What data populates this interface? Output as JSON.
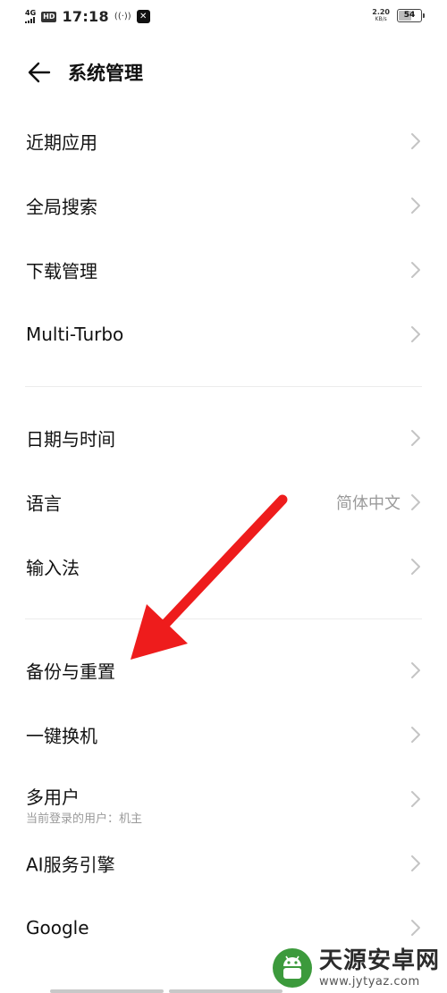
{
  "status_bar": {
    "network": "4G",
    "hd": "HD",
    "time": "17:18",
    "speed_value": "2.20",
    "speed_unit": "KB/s",
    "battery_level": "54",
    "battery_fraction": 0.54
  },
  "header": {
    "title": "系统管理"
  },
  "sections": [
    {
      "items": [
        {
          "label": "近期应用"
        },
        {
          "label": "全局搜索"
        },
        {
          "label": "下载管理"
        },
        {
          "label": "Multi-Turbo"
        }
      ]
    },
    {
      "items": [
        {
          "label": "日期与时间"
        },
        {
          "label": "语言",
          "value": "简体中文"
        },
        {
          "label": "输入法"
        }
      ]
    },
    {
      "items": [
        {
          "label": "备份与重置"
        },
        {
          "label": "一键换机"
        },
        {
          "label": "多用户",
          "sub": "当前登录的用户：机主"
        },
        {
          "label": "AI服务引擎"
        },
        {
          "label": "Google"
        }
      ]
    }
  ],
  "watermark": {
    "name": "天源安卓网",
    "url": "www.jytyaz.com"
  },
  "colors": {
    "annotation_arrow": "#ee1c1c",
    "text_primary": "#111111",
    "text_secondary": "#9a9a9a",
    "chevron": "#c4c4c4",
    "watermark_green": "#3c9a3c"
  },
  "icons": {
    "back": "arrow-left-icon",
    "chevron": "chevron-right-icon"
  }
}
